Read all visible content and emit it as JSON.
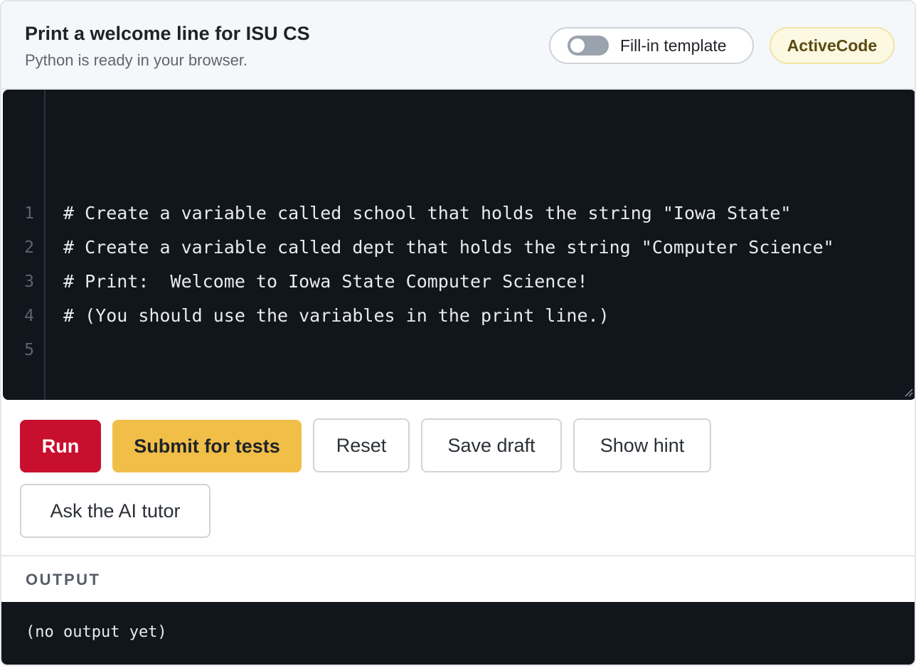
{
  "header": {
    "title": "Print a welcome line for ISU CS",
    "subtitle": "Python is ready in your browser.",
    "toggle_label": "Fill-in template",
    "toggle_on": false,
    "badge": "ActiveCode"
  },
  "editor": {
    "line_numbers": [
      "1",
      "2",
      "3",
      "4",
      "5"
    ],
    "lines": [
      "# Create a variable called school that holds the string \"Iowa State\"",
      "# Create a variable called dept that holds the string \"Computer Science\"",
      "# Print:  Welcome to Iowa State Computer Science!",
      "# (You should use the variables in the print line.)",
      ""
    ]
  },
  "buttons": {
    "run": "Run",
    "submit": "Submit for tests",
    "reset": "Reset",
    "save_draft": "Save draft",
    "show_hint": "Show hint",
    "ask_ai": "Ask the AI tutor"
  },
  "output": {
    "label": "OUTPUT",
    "text": "(no output yet)"
  },
  "colors": {
    "run": "#c8102e",
    "submit": "#f1be48",
    "editor_bg": "#11151c"
  }
}
